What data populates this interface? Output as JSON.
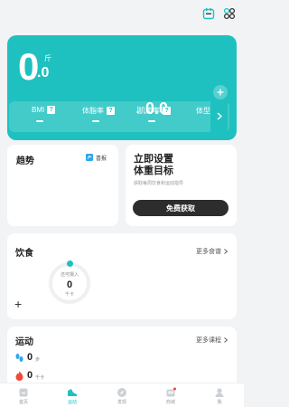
{
  "header": {
    "calendar_icon": "calendar-icon",
    "apps_icon": "apps-icon"
  },
  "summary": {
    "weight_int": "0",
    "weight_dec": ".0",
    "weight_unit": "斤",
    "change_arrow": "↓",
    "change_value": "0.0",
    "metrics": [
      {
        "label": "BMI"
      },
      {
        "label": "体脂率"
      },
      {
        "label": "肌肉率"
      },
      {
        "label": "体型"
      }
    ],
    "accent": "#1fc1c0"
  },
  "trend": {
    "title": "趋势",
    "reference_label": "喜报"
  },
  "goal": {
    "title_line1": "立即设置",
    "title_line2": "体重目标",
    "subtitle": "获取每周饮食和运动指导",
    "button_label": "免费获取"
  },
  "diet": {
    "title": "饮食",
    "more_label": "更多食谱",
    "intake_label": "还可摄入",
    "intake_value": "0",
    "intake_unit": "千卡"
  },
  "sport": {
    "title": "运动",
    "more_label": "更多课程",
    "steps_value": "0",
    "steps_unit": "步",
    "calories_value": "0",
    "calories_unit": "千卡"
  },
  "tabs": [
    {
      "label": "首页"
    },
    {
      "label": "运动"
    },
    {
      "label": "发现"
    },
    {
      "label": "商城"
    },
    {
      "label": "我"
    }
  ]
}
